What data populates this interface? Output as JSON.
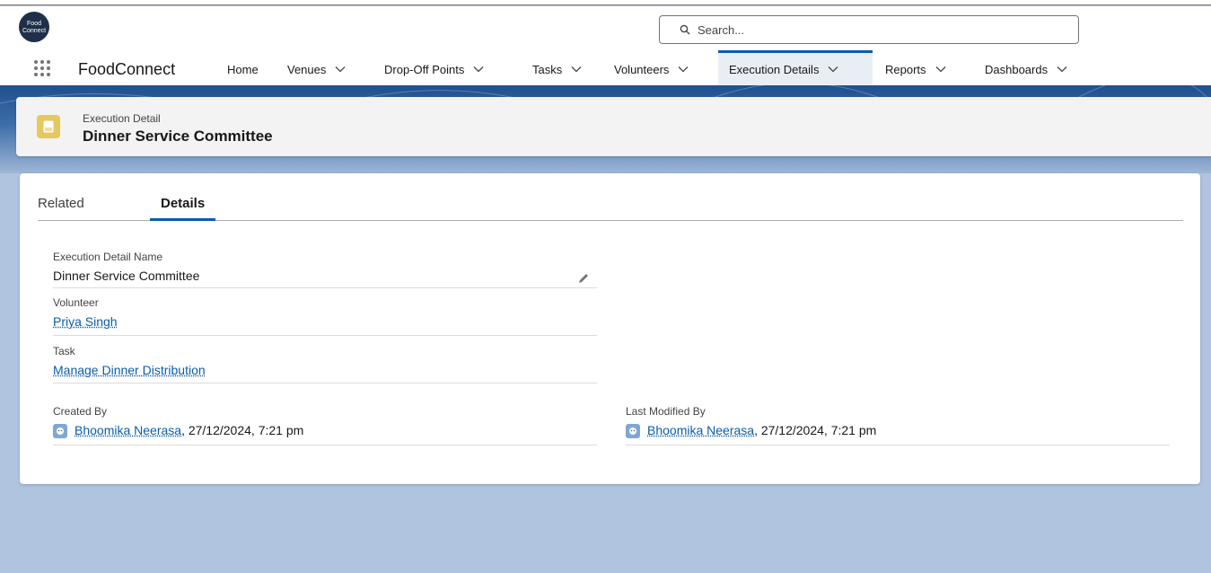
{
  "app": {
    "logo_text": "Food Connect",
    "name": "FoodConnect"
  },
  "search": {
    "placeholder": "Search..."
  },
  "nav": {
    "home": "Home",
    "venues": "Venues",
    "dropoff": "Drop-Off Points",
    "tasks": "Tasks",
    "volunteers": "Volunteers",
    "execution": "Execution Details",
    "reports": "Reports",
    "dashboards": "Dashboards"
  },
  "record": {
    "type": "Execution Detail",
    "title": "Dinner Service Committee"
  },
  "tabs": {
    "related": "Related",
    "details": "Details"
  },
  "fields": {
    "name_label": "Execution Detail Name",
    "name_value": "Dinner Service Committee",
    "volunteer_label": "Volunteer",
    "volunteer_value": "Priya Singh",
    "task_label": "Task",
    "task_value": "Manage Dinner Distribution",
    "created_label": "Created By",
    "created_user": "Bhoomika Neerasa",
    "created_date": ", 27/12/2024, 7:21 pm",
    "modified_label": "Last Modified By",
    "modified_user": "Bhoomika Neerasa",
    "modified_date": ", 27/12/2024, 7:21 pm"
  },
  "colors": {
    "accent": "#0b5cab",
    "icon_yellow": "#e6c95e",
    "background": "#b0c4df"
  }
}
